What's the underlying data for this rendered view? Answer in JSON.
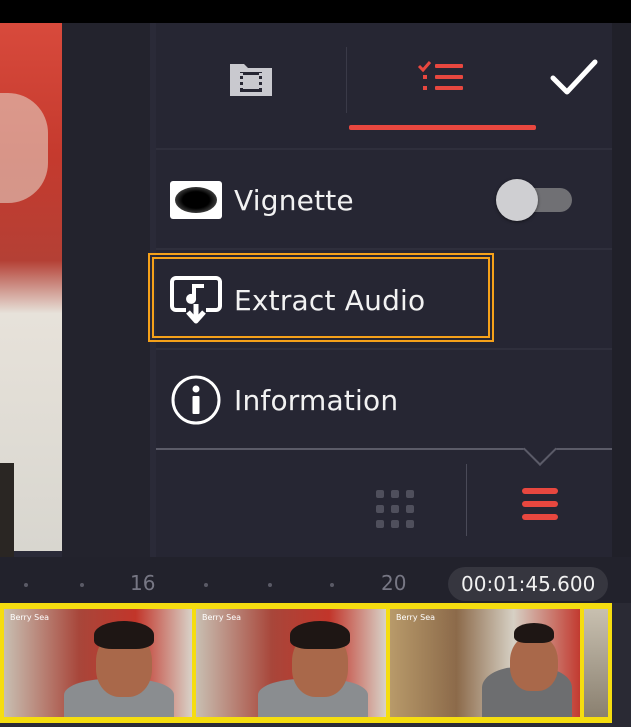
{
  "tabs": [
    {
      "id": "media",
      "icon": "film-folder-icon"
    },
    {
      "id": "list",
      "icon": "checklist-icon",
      "active": true
    },
    {
      "id": "done",
      "icon": "checkmark-icon"
    }
  ],
  "menu": {
    "vignette": {
      "label": "Vignette",
      "icon": "vignette-icon",
      "toggle_on": false
    },
    "extract_audio": {
      "label": "Extract Audio",
      "icon": "extract-audio-icon",
      "highlighted": true
    },
    "information": {
      "label": "Information",
      "icon": "info-icon"
    }
  },
  "bottom_bar": {
    "icons": [
      "grid-icon",
      "hamburger-menu-icon"
    ]
  },
  "timeline": {
    "ruler_labels": [
      "16",
      "20"
    ],
    "timecode": "00:01:45.600",
    "frame_watermark": "Berry Sea"
  },
  "colors": {
    "accent": "#e8473f",
    "highlight": "#f5a11a",
    "panel": "#262633",
    "filmstrip_border": "#f5dd10"
  }
}
